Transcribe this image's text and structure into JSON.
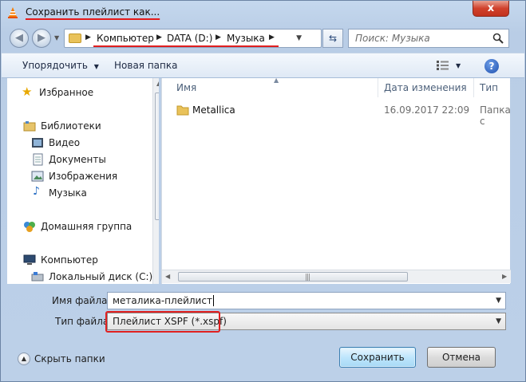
{
  "window": {
    "title": "Сохранить плейлист как...",
    "close_label": "x"
  },
  "address": {
    "crumbs": [
      "Компьютер",
      "DATA (D:)",
      "Музыка"
    ],
    "search_placeholder": "Поиск: Музыка"
  },
  "toolbar": {
    "organize_label": "Упорядочить",
    "new_folder_label": "Новая папка"
  },
  "sidebar": {
    "items": [
      {
        "label": "Избранное",
        "icon": "star-icon"
      },
      {
        "label": "Библиотеки",
        "icon": "libraries-icon"
      },
      {
        "label": "Видео",
        "icon": "video-icon"
      },
      {
        "label": "Документы",
        "icon": "documents-icon"
      },
      {
        "label": "Изображения",
        "icon": "pictures-icon"
      },
      {
        "label": "Музыка",
        "icon": "music-icon"
      },
      {
        "label": "Домашняя группа",
        "icon": "homegroup-icon"
      },
      {
        "label": "Компьютер",
        "icon": "computer-icon"
      },
      {
        "label": "Локальный диск (C:)",
        "icon": "disk-icon"
      }
    ]
  },
  "file_list": {
    "columns": [
      "Имя",
      "Дата изменения",
      "Тип"
    ],
    "rows": [
      {
        "name": "Metallica",
        "date": "16.09.2017 22:09",
        "type": "Папка с"
      }
    ]
  },
  "form": {
    "filename_label": "Имя файла:",
    "filename_value": "металика-плейлист",
    "filetype_label": "Тип файла:",
    "filetype_value": "Плейлист XSPF (*.xspf)"
  },
  "footer": {
    "hide_folders_label": "Скрыть папки",
    "save_label": "Сохранить",
    "cancel_label": "Отмена"
  },
  "colors": {
    "highlight": "#e02020",
    "window_frame": "#c5d8ee",
    "accent": "#3c7fb1"
  }
}
